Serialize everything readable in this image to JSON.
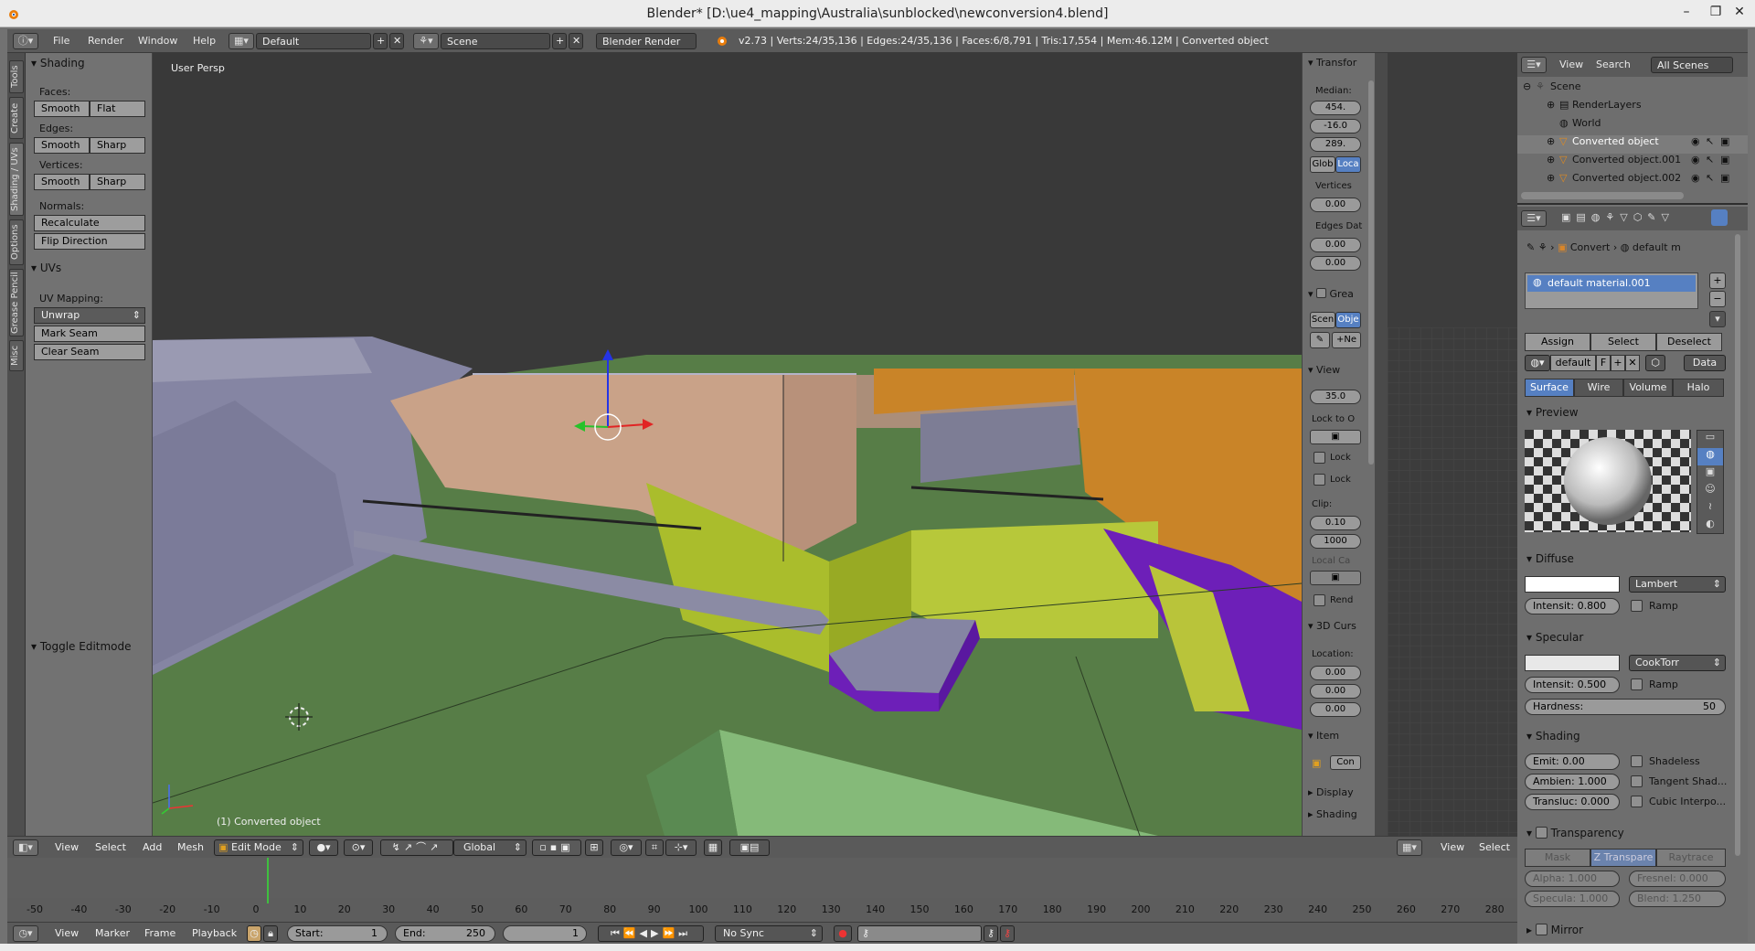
{
  "window": {
    "title": "Blender* [D:\\ue4_mapping\\Australia\\sunblocked\\newconversion4.blend]",
    "minimize": "–",
    "maximize": "❐",
    "close": "✕"
  },
  "info_header": {
    "menus": [
      "File",
      "Render",
      "Window",
      "Help"
    ],
    "layout": "Default",
    "scene": "Scene",
    "render_engine": "Blender Render",
    "stats": "v2.73 | Verts:24/35,136 | Edges:24/35,136 | Faces:6/8,791 | Tris:17,554 | Mem:46.12M | Converted object"
  },
  "tool_tabs": [
    "Tools",
    "Create",
    "Shading / UVs",
    "Options",
    "Grease Pencil",
    "Misc"
  ],
  "tool_shelf": {
    "shading_header": "Shading",
    "faces_label": "Faces:",
    "faces_buttons": [
      "Smooth",
      "Flat"
    ],
    "edges_label": "Edges:",
    "edges_buttons": [
      "Smooth",
      "Sharp"
    ],
    "vertices_label": "Vertices:",
    "vertices_buttons": [
      "Smooth",
      "Sharp"
    ],
    "normals_label": "Normals:",
    "recalculate": "Recalculate",
    "flip_direction": "Flip Direction",
    "uvs_header": "UVs",
    "uv_mapping_label": "UV Mapping:",
    "unwrap": "Unwrap",
    "mark_seam": "Mark Seam",
    "clear_seam": "Clear Seam",
    "toggle_editmode": "Toggle Editmode"
  },
  "viewport": {
    "view_name": "User Persp",
    "object_label": "(1) Converted object"
  },
  "n_panel": {
    "transform_header": "Transfor",
    "median_label": "Median:",
    "median_values": [
      "454.",
      "-16.0",
      "289."
    ],
    "global_btn": "Glob",
    "local_btn": "Loca",
    "vertices_label": "Vertices",
    "vertices_value": "0.00",
    "edges_label": "Edges Dat",
    "edges_values": [
      "0.00",
      "0.00"
    ],
    "grease_header": "Grea",
    "scene_btn": "Scen",
    "object_btn": "Obje",
    "new_btn": "Ne",
    "view_header": "View",
    "lens_value": "35.0",
    "lock_to_label": "Lock to O",
    "lock1": "Lock",
    "lock2": "Lock",
    "clip_label": "Clip:",
    "clip_start": "0.10",
    "clip_end": "1000",
    "local_cam_label": "Local Ca",
    "render_label": "Rend",
    "cursor_header": "3D Curs",
    "location_label": "Location:",
    "cursor_values": [
      "0.00",
      "0.00",
      "0.00"
    ],
    "item_header": "Item",
    "item_value": "Con",
    "display_header": "Display",
    "shading_header": "Shading"
  },
  "outliner": {
    "menus": [
      "View",
      "Search"
    ],
    "filter": "All Scenes",
    "rows": [
      "Scene",
      "RenderLayers",
      "World",
      "Converted object",
      "Converted object.001",
      "Converted object.002"
    ]
  },
  "properties": {
    "breadcrumb_object": "Convert",
    "breadcrumb_material": "default m",
    "material_slot": "default material.001",
    "assign": "Assign",
    "select": "Select",
    "deselect": "Deselect",
    "material_name": "default",
    "fake_user": "F",
    "link": "Data",
    "tabs": [
      "Surface",
      "Wire",
      "Volume",
      "Halo"
    ],
    "preview_header": "Preview",
    "diffuse_header": "Diffuse",
    "diffuse_shader": "Lambert",
    "diffuse_intensity": "Intensit: 0.800",
    "ramp1": "Ramp",
    "specular_header": "Specular",
    "specular_shader": "CookTorr",
    "specular_intensity": "Intensit: 0.500",
    "ramp2": "Ramp",
    "hardness_label": "Hardness:",
    "hardness_value": "50",
    "shading_header": "Shading",
    "emit": "Emit:  0.00",
    "ambient": "Ambien: 1.000",
    "translucency": "Transluc: 0.000",
    "shadeless": "Shadeless",
    "tangent": "Tangent Shad...",
    "cubic": "Cubic Interpo...",
    "transparency_header": "Transparency",
    "trans_tabs": [
      "Mask",
      "Z Transpare",
      "Raytrace"
    ],
    "alpha": "Alpha:  1.000",
    "fresnel": "Fresnel: 0.000",
    "specular_t": "Specula: 1.000",
    "blend": "Blend:  1.250",
    "mirror_header": "Mirror"
  },
  "viewport_header": {
    "menus": [
      "View",
      "Select",
      "Add",
      "Mesh"
    ],
    "mode": "Edit Mode",
    "orientation": "Global"
  },
  "uv_header": {
    "menus": [
      "View",
      "Select"
    ]
  },
  "timeline": {
    "ticks": [
      "-50",
      "-40",
      "-30",
      "-20",
      "-10",
      "0",
      "10",
      "20",
      "30",
      "40",
      "50",
      "60",
      "70",
      "80",
      "90",
      "100",
      "110",
      "120",
      "130",
      "140",
      "150",
      "160",
      "170",
      "180",
      "190",
      "200",
      "210",
      "220",
      "230",
      "240",
      "250",
      "260",
      "270",
      "280"
    ],
    "current_frame_marker": 0
  },
  "timeline_header": {
    "menus": [
      "View",
      "Marker",
      "Frame",
      "Playback"
    ],
    "start": "Start:",
    "start_value": "1",
    "end": "End:",
    "end_value": "250",
    "current": "1",
    "sync": "No Sync"
  },
  "colors": {
    "selection_blue": "#5680c2",
    "ground_green": "#577d47",
    "wall_peach": "#c9a288",
    "wall_orange": "#c98428",
    "yellow_green": "#aabd2c",
    "purple": "#6d1fb8",
    "gray_blue": "#8585a3"
  }
}
